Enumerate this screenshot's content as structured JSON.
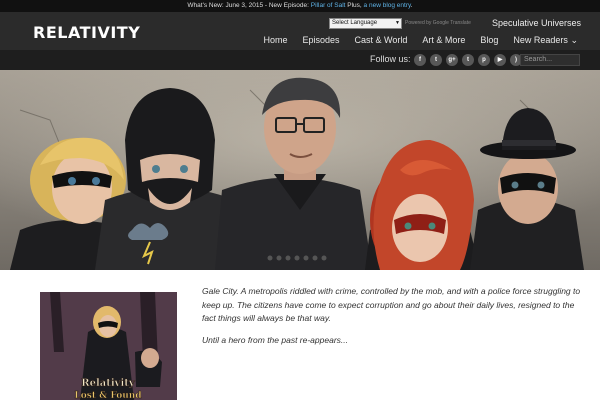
{
  "announcement": {
    "prefix": "What's New: June 3, 2015 - New Episode:",
    "episode_link": "Pillar of Salt",
    "middle": "Plus,",
    "blog_link": "a new blog entry"
  },
  "header": {
    "logo": "RELATIVITY",
    "language_select": "Select Language",
    "powered_by": "Powered by Google Translate",
    "spec_link": "Speculative Universes",
    "nav": [
      "Home",
      "Episodes",
      "Cast & World",
      "Art & More",
      "Blog",
      "New Readers"
    ]
  },
  "follow": {
    "label": "Follow us:",
    "icons": [
      {
        "name": "facebook-icon",
        "glyph": "f"
      },
      {
        "name": "twitter-icon",
        "glyph": "t"
      },
      {
        "name": "google-plus-icon",
        "glyph": "g+"
      },
      {
        "name": "tumblr-icon",
        "glyph": "t"
      },
      {
        "name": "pinterest-icon",
        "glyph": "p"
      },
      {
        "name": "youtube-icon",
        "glyph": "▶"
      },
      {
        "name": "rss-icon",
        "glyph": ")"
      }
    ],
    "search_placeholder": "Search..."
  },
  "cover": {
    "title_line1": "Relativity",
    "title_line2": "Lost & Found"
  },
  "intro": {
    "paragraph1": "Gale City. A metropolis riddled with crime, controlled by the mob, and with a police force struggling to keep up. The citizens have come to expect corruption and go about their daily lives, resigned to the fact things will always be that way.",
    "paragraph2": "Until a hero from the past re-appears..."
  },
  "colors": {
    "topbar": "#111111",
    "header": "#2b2b2b",
    "followbar": "#1e1e1e",
    "link": "#5fb3e6"
  }
}
